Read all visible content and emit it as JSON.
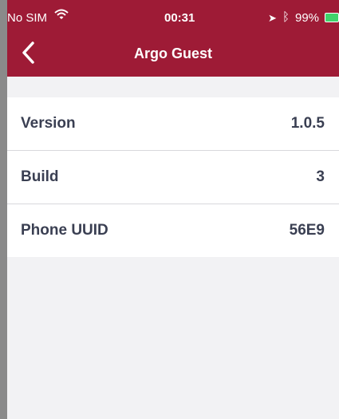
{
  "status_bar": {
    "carrier": "No SIM",
    "time": "00:31",
    "battery": "99%"
  },
  "nav": {
    "title": "Argo Guest",
    "back_icon": "chevron-left-icon"
  },
  "info_rows": [
    {
      "label": "Version",
      "value": "1.0.5"
    },
    {
      "label": "Build",
      "value": "3"
    },
    {
      "label": "Phone UUID",
      "value": "56E9"
    }
  ],
  "colors": {
    "brand": "#9e1b36",
    "background": "#f2f2f4",
    "battery": "#40d26b"
  }
}
